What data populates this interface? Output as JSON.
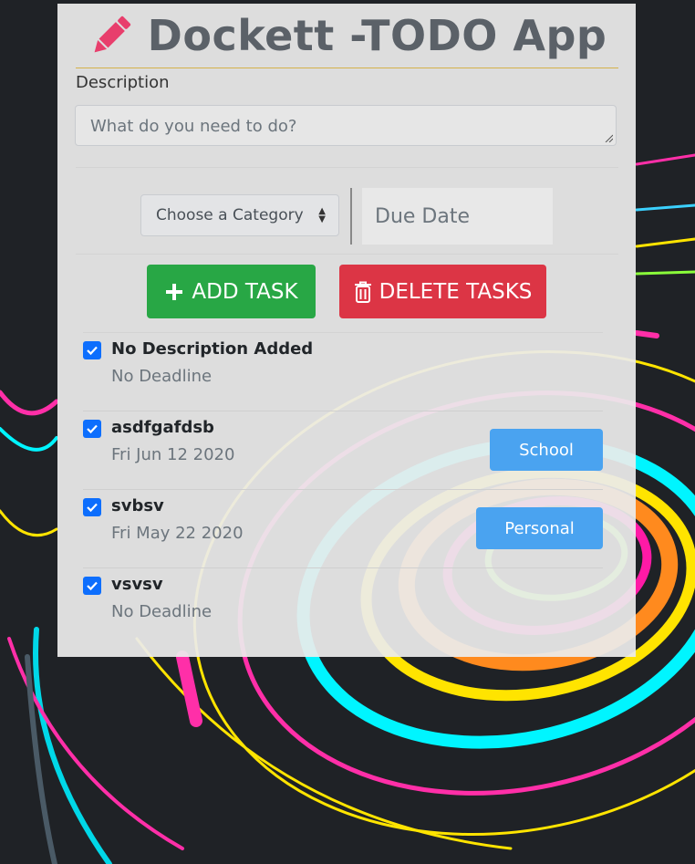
{
  "app": {
    "title": "Dockett -TODO App"
  },
  "form": {
    "description_label": "Description",
    "description_placeholder": "What do you need to do?",
    "category_select": "Choose a Category",
    "due_date_placeholder": "Due Date"
  },
  "actions": {
    "add_label": "ADD TASK",
    "delete_label": "DELETE TASKS"
  },
  "tasks": [
    {
      "name": "No Description Added",
      "deadline": "No Deadline",
      "category": "",
      "checked": true
    },
    {
      "name": "asdfgafdsb",
      "deadline": "Fri Jun 12 2020",
      "category": "School",
      "checked": true
    },
    {
      "name": "svbsv",
      "deadline": "Fri May 22 2020",
      "category": "Personal",
      "checked": true
    },
    {
      "name": "vsvsv",
      "deadline": "No Deadline",
      "category": "",
      "checked": true
    }
  ],
  "colors": {
    "add_button": "#28a745",
    "delete_button": "#dc3545",
    "badge": "#4aa3f0",
    "checkbox": "#0d6efd",
    "pencil": "#e83e6c"
  },
  "icons": {
    "title": "pencil-icon",
    "add": "plus-icon",
    "delete": "trash-icon",
    "checkbox": "check-icon"
  }
}
